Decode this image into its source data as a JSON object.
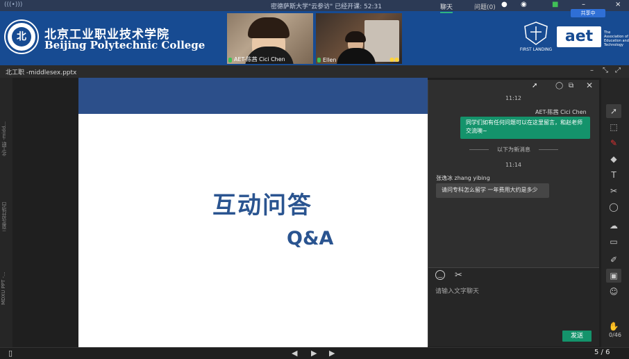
{
  "topbar": {
    "left_text": "(((•)))",
    "meeting_status": "密德萨斯大学\"云参访\"  已经开课: 52:31"
  },
  "banner": {
    "college_cn": "北京工业职业技术学院",
    "college_en": "Beijing Polytechnic College",
    "logo_text": "北",
    "share_badge": "共享中",
    "first_landing": "FIRST LANDING",
    "aet_logo": "aet",
    "aet_text": "The Association of Education and Technology",
    "videos": [
      {
        "name": "AET-陈茜 Cici Chen"
      },
      {
        "name": "Ellen",
        "badge": "●●"
      }
    ]
  },
  "docbar": {
    "title": "北工职 -middlesex.pptx"
  },
  "leftstrip": {
    "tabs": [
      "北工职 -midd...",
      "云参访开场白",
      "MDXU PPT -..."
    ]
  },
  "slide": {
    "title": "互动问答",
    "subtitle": "Q&A"
  },
  "chat": {
    "tab_chat": "聊天",
    "tab_questions": "问题(0)",
    "time1": "11:12",
    "sender1": "AET-陈茜 Cici Chen",
    "message1": "同学们如有任何问题可以在这里留言，和赵老师交流噢~",
    "new_messages_divider": "以下为新消息",
    "time2": "11:14",
    "sender2": "张逸冰 zhang yibing",
    "message2": "请问专科怎么留学 一年费用大约是多少",
    "input_placeholder": "请输入文字聊天",
    "send_label": "发送"
  },
  "toolbar": {
    "counter": "0/46"
  },
  "bottombar": {
    "page": "5 / 6"
  }
}
